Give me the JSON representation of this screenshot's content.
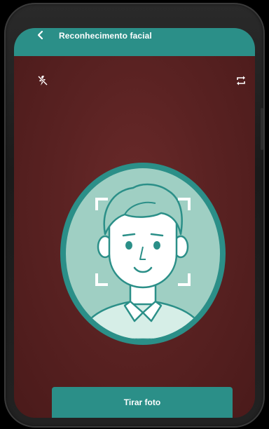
{
  "app_bar": {
    "title": "Reconhecimento facial",
    "back_icon": "chevron-left-icon",
    "color": "#2b8f88"
  },
  "camera_controls": {
    "flash_icon": "flash-off-icon",
    "switch_icon": "switch-camera-icon"
  },
  "face_guide": {
    "icon": "face-avatar-icon",
    "frame_color": "#2b8f88",
    "fill_color": "#9fcfc3"
  },
  "capture_button": {
    "label": "Tirar foto",
    "color": "#2b8f88"
  },
  "background_color": "#5a2222"
}
